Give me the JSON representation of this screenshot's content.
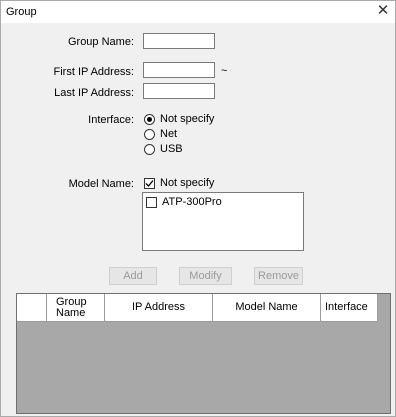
{
  "window": {
    "title": "Group",
    "close_glyph": "✕"
  },
  "form": {
    "group_name": {
      "label": "Group Name:",
      "value": ""
    },
    "first_ip": {
      "label": "First IP Address:",
      "value": ""
    },
    "range_separator": "~",
    "last_ip": {
      "label": "Last IP Address:",
      "value": ""
    },
    "interface": {
      "label": "Interface:",
      "options": [
        "Not specify",
        "Net",
        "USB"
      ],
      "selected": "Not specify"
    },
    "model_name": {
      "label": "Model Name:",
      "not_specify_label": "Not specify",
      "not_specify_checked": true,
      "list_items": [
        {
          "label": "ATP-300Pro",
          "checked": false
        }
      ]
    }
  },
  "buttons": {
    "add": "Add",
    "modify": "Modify",
    "remove": "Remove"
  },
  "table": {
    "columns": [
      "",
      "Group\nName",
      "IP Address",
      "Model Name",
      "Interface"
    ],
    "rows": []
  }
}
